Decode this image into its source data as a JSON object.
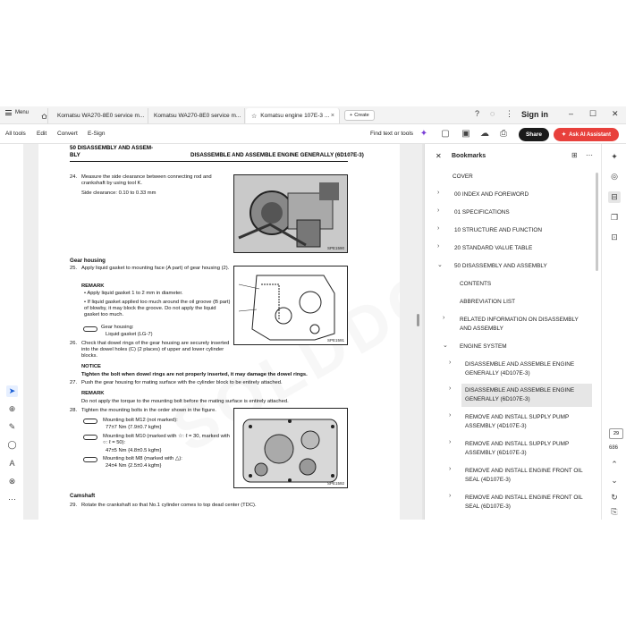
{
  "tabs": {
    "menu_label": "Menu",
    "items": [
      {
        "label": "Komatsu WA270-8E0 service m...",
        "active": false
      },
      {
        "label": "Komatsu WA270-8E0 service m...",
        "active": false
      },
      {
        "label": "Komatsu engine 107E-3 ...",
        "active": true
      }
    ],
    "create_label": "Create",
    "signin_label": "Sign in"
  },
  "toolbar": {
    "menu": [
      "All tools",
      "Edit",
      "Convert",
      "E-Sign"
    ],
    "find_label": "Find text or tools",
    "share_label": "Share",
    "ai_label": "Ask AI Assistant"
  },
  "document": {
    "header_left": "50 DISASSEMBLY AND ASSEM-\nBLY",
    "header_right": "DISASSEMBLE AND ASSEMBLE ENGINE GENERALLY (6D107E-3)",
    "step24_num": "24.",
    "step24_text": "Measure the side clearance between connecting rod and crankshaft by using tool K.",
    "step24_clearance": "Side clearance: 0.10 to 0.33 mm",
    "fig1_label": "SPE1590",
    "section_gear": "Gear housing",
    "step25_num": "25.",
    "step25_text": "Apply liquid gasket to mounting face (A part) of gear housing (2).",
    "remark1": "REMARK",
    "bullet1": "Apply liquid gasket 1 to 2 mm in diameter.",
    "bullet2": "If liquid gasket applied too much around the oil groove (B part) of blowby, it may block the groove. Do not apply the liquid gasket too much.",
    "gasket_label": "Gear housing:",
    "gasket_value": "Liquid gasket (LG-7)",
    "fig2_label": "SPE1591",
    "step26_num": "26.",
    "step26_text": "Check that dowel rings of the gear housing are securely inserted into the dowel holes (C) (2 places) of upper and lower cylinder blocks.",
    "notice": "NOTICE",
    "notice_text": "Tighten the bolt when dowel rings are not properly inserted, it may damage the dowel rings.",
    "step27_num": "27.",
    "step27_text": "Push the gear housing for mating surface with the cylinder block to be entirely attached.",
    "remark2": "REMARK",
    "remark2_text": "Do not apply the torque to the mounting bolt before the mating surface is entirely attached.",
    "step28_num": "28.",
    "step28_text": "Tighten the mounting bolts in the order shown in the figure.",
    "bolt1_label": "Mounting bolt M12 (not marked):",
    "bolt1_value": "77±7 Nm {7.9±0.7 kgfm}",
    "bolt2_label": "Mounting bolt M10 (marked with ☆: ℓ = 30, marked with ○: ℓ = 50):",
    "bolt2_value": "47±5 Nm {4.8±0.5 kgfm}",
    "bolt3_label": "Mounting bolt M8 (marked with △):",
    "bolt3_value": "24±4 Nm {2.5±0.4 kgfm}",
    "fig3_label": "SPE1592",
    "section_cam": "Camshaft",
    "step29_num": "29.",
    "step29_text": "Rotate the crankshaft so that No.1 cylinder comes to top dead center (TDC).",
    "watermark": "SOLDDO.COM"
  },
  "bookmarks": {
    "title": "Bookmarks",
    "items": [
      {
        "label": "COVER",
        "chevron": ""
      },
      {
        "label": "00 INDEX AND FOREWORD",
        "chevron": "›"
      },
      {
        "label": "01 SPECIFICATIONS",
        "chevron": "›"
      },
      {
        "label": "10 STRUCTURE AND FUNCTION",
        "chevron": "›"
      },
      {
        "label": "20 STANDARD VALUE TABLE",
        "chevron": "›"
      },
      {
        "label": "50 DISASSEMBLY AND ASSEMBLY",
        "chevron": "⌄"
      },
      {
        "label": "CONTENTS",
        "chevron": ""
      },
      {
        "label": "ABBREVIATION LIST",
        "chevron": ""
      },
      {
        "label": "RELATED INFORMATION ON DISASSEMBLY AND ASSEMBLY",
        "chevron": "›"
      },
      {
        "label": "ENGINE SYSTEM",
        "chevron": "⌄"
      },
      {
        "label": "DISASSEMBLE AND ASSEMBLE ENGINE GENERALLY (4D107E-3)",
        "chevron": "›"
      },
      {
        "label": "DISASSEMBLE AND ASSEMBLE ENGINE GENERALLY (6D107E-3)",
        "chevron": "›",
        "selected": true
      },
      {
        "label": "REMOVE AND INSTALL SUPPLY PUMP ASSEMBLY (4D107E-3)",
        "chevron": "›"
      },
      {
        "label": "REMOVE AND INSTALL SUPPLY PUMP ASSEMBLY (6D107E-3)",
        "chevron": "›"
      },
      {
        "label": "REMOVE AND INSTALL ENGINE FRONT OIL SEAL (4D107E-3)",
        "chevron": "›"
      },
      {
        "label": "REMOVE AND INSTALL ENGINE FRONT OIL SEAL (6D107E-3)",
        "chevron": "›"
      }
    ]
  },
  "rightrail": {
    "page_current": "29",
    "page_total": "686"
  },
  "colors": {
    "accent": "#e8413c",
    "selected_tool": "#1a5fd6",
    "share_bg": "#1a1a1a"
  }
}
